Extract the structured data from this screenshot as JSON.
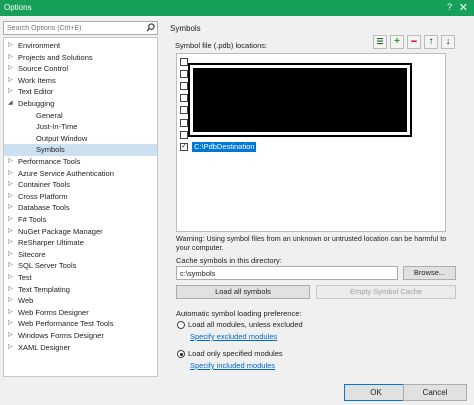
{
  "window": {
    "title": "Options",
    "help_glyph": "?",
    "close_glyph": "✕"
  },
  "search": {
    "placeholder": "Search Options (Ctrl+E)"
  },
  "tree": {
    "items": [
      {
        "label": "Environment",
        "arrow": "▷",
        "indent": 0,
        "selected": false
      },
      {
        "label": "Projects and Solutions",
        "arrow": "▷",
        "indent": 0,
        "selected": false
      },
      {
        "label": "Source Control",
        "arrow": "▷",
        "indent": 0,
        "selected": false
      },
      {
        "label": "Work Items",
        "arrow": "▷",
        "indent": 0,
        "selected": false
      },
      {
        "label": "Text Editor",
        "arrow": "▷",
        "indent": 0,
        "selected": false
      },
      {
        "label": "Debugging",
        "arrow": "◢",
        "indent": 0,
        "selected": false
      },
      {
        "label": "General",
        "arrow": "",
        "indent": 1,
        "selected": false
      },
      {
        "label": "Just-In-Time",
        "arrow": "",
        "indent": 1,
        "selected": false
      },
      {
        "label": "Output Window",
        "arrow": "",
        "indent": 1,
        "selected": false
      },
      {
        "label": "Symbols",
        "arrow": "",
        "indent": 1,
        "selected": true
      },
      {
        "label": "Performance Tools",
        "arrow": "▷",
        "indent": 0,
        "selected": false
      },
      {
        "label": "Azure Service Authentication",
        "arrow": "▷",
        "indent": 0,
        "selected": false
      },
      {
        "label": "Container Tools",
        "arrow": "▷",
        "indent": 0,
        "selected": false
      },
      {
        "label": "Cross Platform",
        "arrow": "▷",
        "indent": 0,
        "selected": false
      },
      {
        "label": "Database Tools",
        "arrow": "▷",
        "indent": 0,
        "selected": false
      },
      {
        "label": "F# Tools",
        "arrow": "▷",
        "indent": 0,
        "selected": false
      },
      {
        "label": "NuGet Package Manager",
        "arrow": "▷",
        "indent": 0,
        "selected": false
      },
      {
        "label": "ReSharper Ultimate",
        "arrow": "▷",
        "indent": 0,
        "selected": false
      },
      {
        "label": "Sitecore",
        "arrow": "▷",
        "indent": 0,
        "selected": false
      },
      {
        "label": "SQL Server Tools",
        "arrow": "▷",
        "indent": 0,
        "selected": false
      },
      {
        "label": "Test",
        "arrow": "▷",
        "indent": 0,
        "selected": false
      },
      {
        "label": "Text Templating",
        "arrow": "▷",
        "indent": 0,
        "selected": false
      },
      {
        "label": "Web",
        "arrow": "▷",
        "indent": 0,
        "selected": false
      },
      {
        "label": "Web Forms Designer",
        "arrow": "▷",
        "indent": 0,
        "selected": false
      },
      {
        "label": "Web Performance Test Tools",
        "arrow": "▷",
        "indent": 0,
        "selected": false
      },
      {
        "label": "Windows Forms Designer",
        "arrow": "▷",
        "indent": 0,
        "selected": false
      },
      {
        "label": "XAML Designer",
        "arrow": "▷",
        "indent": 0,
        "selected": false
      }
    ]
  },
  "symbols": {
    "section_title": "Symbols",
    "locations_label": "Symbol file (.pdb) locations:",
    "toolbar": {
      "filter_glyph": "☰",
      "add_glyph": "+",
      "remove_glyph": "━",
      "up_glyph": "↑",
      "down_glyph": "↓",
      "add_color": "#2a9a2a",
      "remove_color": "#d42020"
    },
    "locations": [
      {
        "path": "",
        "checked": false,
        "selected": false
      },
      {
        "path": "",
        "checked": false,
        "selected": false
      },
      {
        "path": "",
        "checked": false,
        "selected": false
      },
      {
        "path": "",
        "checked": false,
        "selected": false
      },
      {
        "path": "",
        "checked": false,
        "selected": false
      },
      {
        "path": "",
        "checked": false,
        "selected": false
      },
      {
        "path": "",
        "checked": false,
        "selected": false
      },
      {
        "path": "C:\\PdbDestination",
        "checked": true,
        "selected": true
      }
    ],
    "warning": "Warning: Using symbol files from an unknown or untrusted location can be harmful to your computer.",
    "cache_label": "Cache symbols in this directory:",
    "cache_value": "c:\\symbols",
    "browse_label": "Browse...",
    "load_all_label": "Load all symbols",
    "empty_cache_label": "Empty Symbol Cache",
    "auto_label": "Automatic symbol loading preference:",
    "option_all_label": "Load all modules, unless excluded",
    "excluded_link": "Specify excluded modules",
    "option_specified_label": "Load only specified modules",
    "included_link": "Specify included modules",
    "selected_option": "specified"
  },
  "footer": {
    "ok_label": "OK",
    "cancel_label": "Cancel"
  }
}
